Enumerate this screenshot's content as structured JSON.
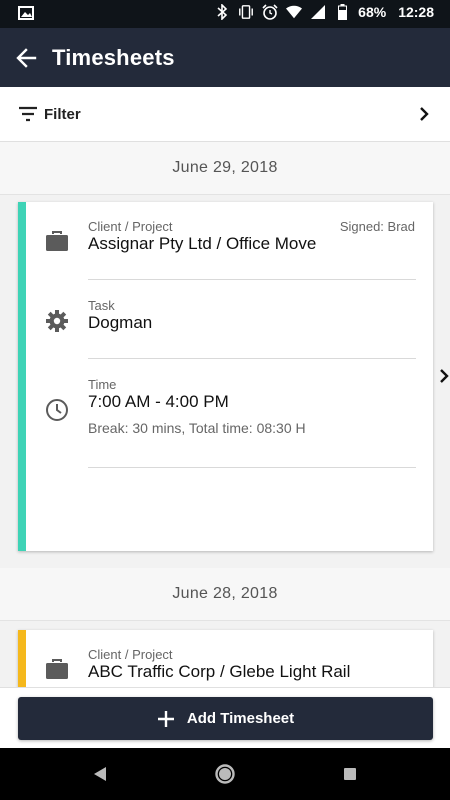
{
  "status_bar": {
    "battery": "68%",
    "time": "12:28",
    "icons": [
      "image-icon",
      "bluetooth-icon",
      "vibrate-icon",
      "alarm-icon",
      "wifi-icon",
      "signal-icon",
      "battery-icon"
    ]
  },
  "app_bar": {
    "title": "Timesheets",
    "back_icon": "arrow-left-icon"
  },
  "filter": {
    "label": "Filter",
    "icon": "filter-icon",
    "chevron_icon": "chevron-right-icon"
  },
  "groups": [
    {
      "date": "June 29, 2018",
      "card": {
        "accent_color": "#3ed3b6",
        "signed": "Signed: Brad",
        "client_label": "Client / Project",
        "client_value": "Assignar Pty Ltd / Office Move",
        "task_label": "Task",
        "task_value": "Dogman",
        "time_label": "Time",
        "time_value": "7:00 AM - 4:00 PM",
        "time_detail": "Break: 30 mins, Total time: 08:30 H"
      }
    },
    {
      "date": "June 28, 2018",
      "card": {
        "accent_color": "#f5b81c",
        "client_label": "Client / Project",
        "client_value": "ABC Traffic Corp / Glebe Light Rail"
      }
    }
  ],
  "add_button": {
    "label": "Add Timesheet",
    "icon": "plus-icon"
  },
  "colors": {
    "app_bar": "#232a3a",
    "status_bar": "#0f1419",
    "accent_teal": "#3ed3b6",
    "accent_yellow": "#f5b81c"
  }
}
